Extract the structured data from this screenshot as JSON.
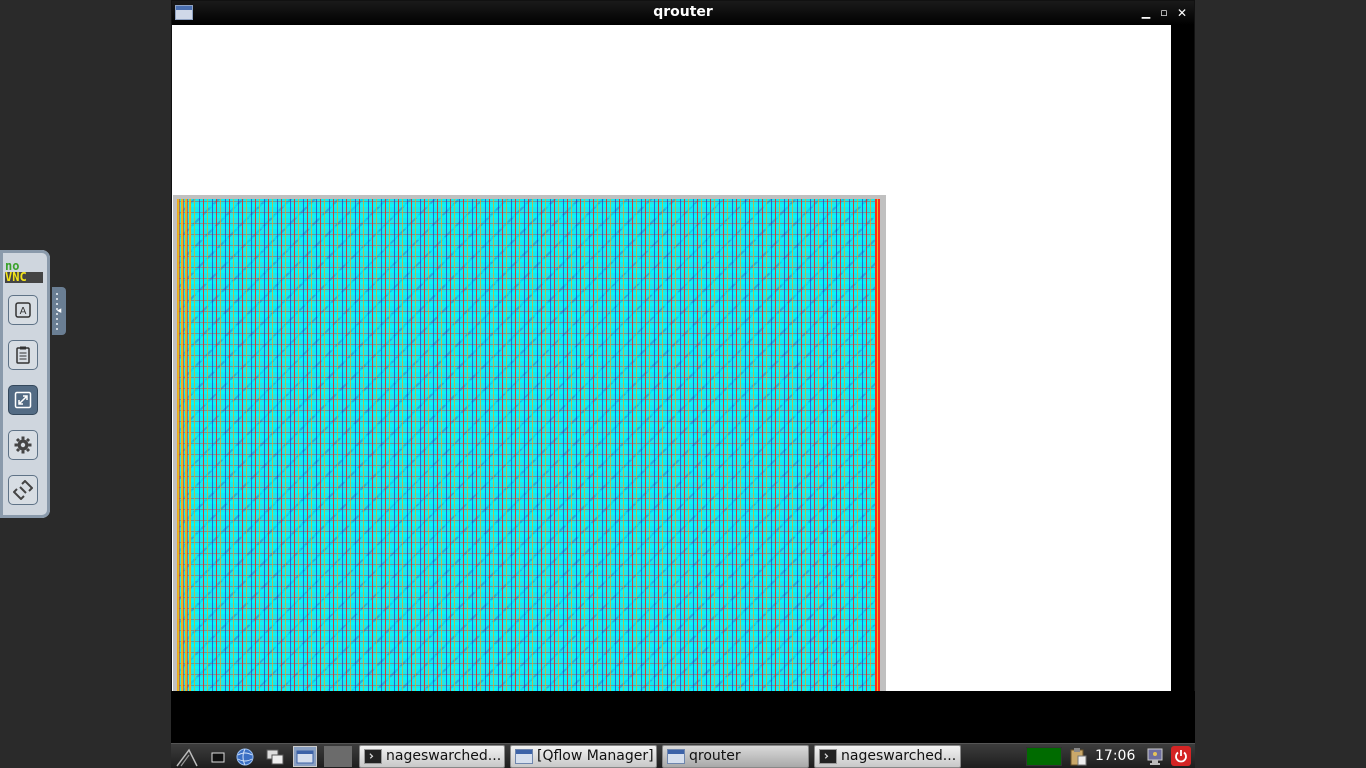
{
  "window": {
    "title": "qrouter",
    "controls": {
      "minimize": "▁",
      "maximize": "▫",
      "close": "✕"
    }
  },
  "novnc": {
    "logo_top": "no",
    "logo_bottom": "VNC",
    "buttons": [
      {
        "name": "keyboard-icon"
      },
      {
        "name": "clipboard-icon"
      },
      {
        "name": "fullscreen-icon",
        "active": true
      },
      {
        "name": "settings-gear-icon"
      },
      {
        "name": "disconnect-icon"
      }
    ]
  },
  "taskbar": {
    "tasks": [
      {
        "label": "nageswarched...",
        "icon": "terminal-icon"
      },
      {
        "label": "[Qflow Manager]",
        "icon": "window-icon"
      },
      {
        "label": "qrouter",
        "icon": "window-icon",
        "active": true
      },
      {
        "label": "nageswarched...",
        "icon": "terminal-icon"
      }
    ],
    "clock": "17:06"
  },
  "colors": {
    "layout_background": "#22e5e8",
    "metal_red": "#e6281e",
    "metal_yellow": "#f0aa14",
    "metal_blue": "#2828c8",
    "cpu_meter": "#006b00"
  }
}
